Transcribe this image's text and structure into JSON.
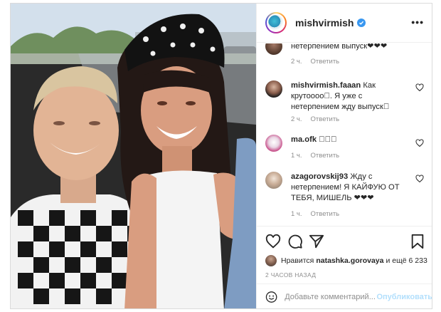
{
  "post": {
    "username": "mishvirmish",
    "verified": true
  },
  "comments": [
    {
      "username": "",
      "text": "нетерпением выпуск❤❤❤",
      "time": "2 ч.",
      "reply": "Ответить"
    },
    {
      "username": "mishvirmish.faaan",
      "text": "Как крутоооо\u0000. Я уже с нетерпением жду выпуск\u0000",
      "time": "2 ч.",
      "reply": "Ответить"
    },
    {
      "username": "ma.ofk",
      "text": "\u0000\u0000\u0000",
      "time": "1 ч.",
      "reply": "Ответить"
    },
    {
      "username": "azagorovskij93",
      "text": "Жду с нетерпением! Я КАЙФУЮ ОТ ТЕБЯ, МИШЕЛЬ ❤❤❤",
      "time": "1 ч.",
      "reply": "Ответить"
    }
  ],
  "likes": {
    "prefix": "Нравится",
    "user": "natashka.gorovaya",
    "suffix": "и ещё 6 233"
  },
  "time_ago": "2 ЧАСОВ НАЗАД",
  "comment_box": {
    "placeholder": "Добавьте комментарий...",
    "publish": "Опубликовать"
  },
  "icons": {
    "like": "heart-icon",
    "comment": "comment-icon",
    "share": "share-icon",
    "save": "bookmark-icon",
    "emoji": "smiley-icon",
    "more": "more-dots-icon"
  },
  "colors": {
    "verified": "#3897f0",
    "publish_disabled": "#b2dffc",
    "muted_text": "#8e8e8e",
    "border": "#efefef"
  }
}
